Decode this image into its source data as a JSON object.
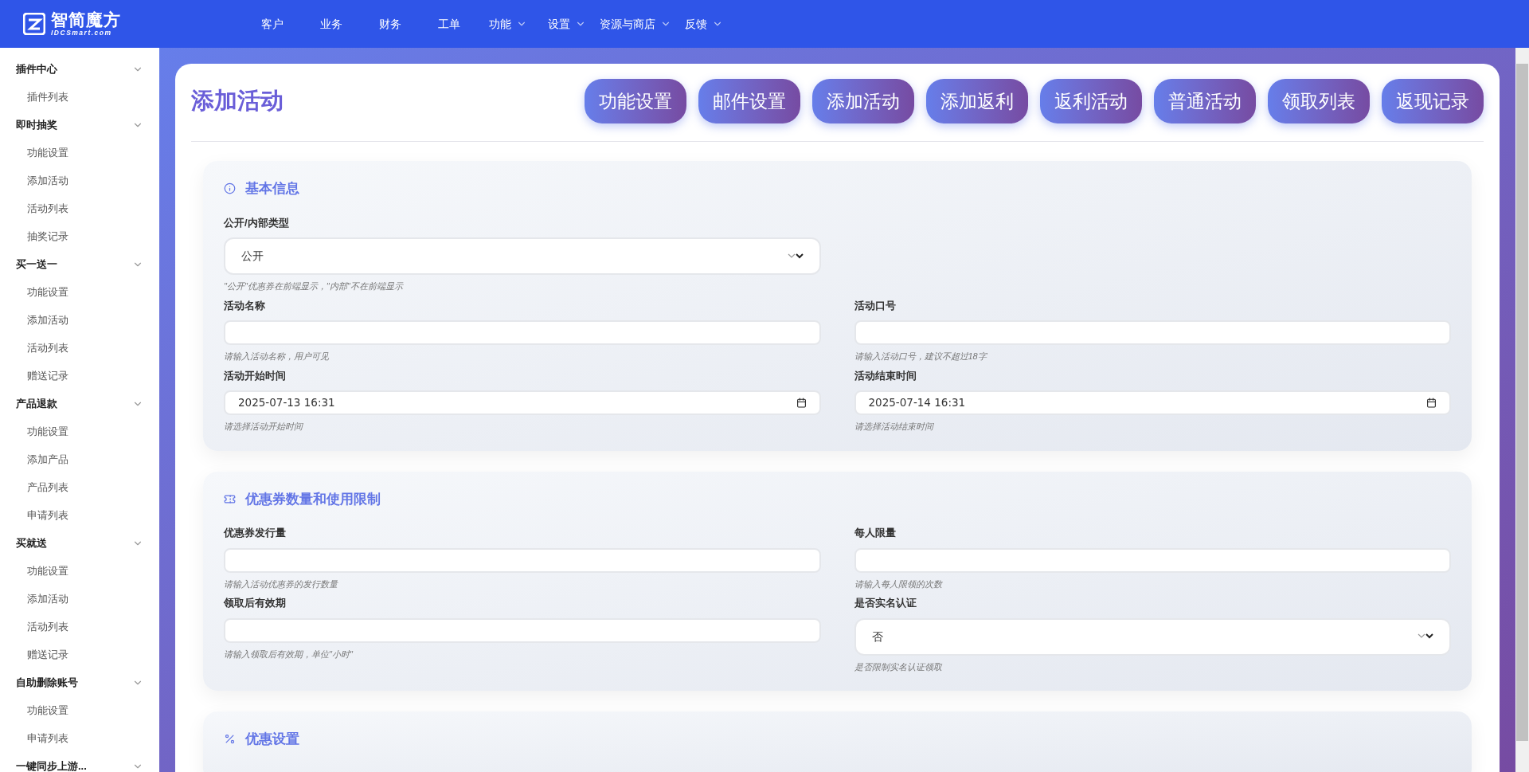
{
  "brand": {
    "name": "智简魔方",
    "domain": "IDCSmart.com"
  },
  "nav": [
    {
      "label": "客户",
      "dropdown": false
    },
    {
      "label": "业务",
      "dropdown": false
    },
    {
      "label": "财务",
      "dropdown": false
    },
    {
      "label": "工单",
      "dropdown": false
    },
    {
      "label": "功能",
      "dropdown": true
    },
    {
      "label": "设置",
      "dropdown": true
    },
    {
      "label": "资源与商店",
      "dropdown": true
    },
    {
      "label": "反馈",
      "dropdown": true
    }
  ],
  "sidebar": [
    {
      "label": "插件中心",
      "children": [
        "插件列表"
      ]
    },
    {
      "label": "即时抽奖",
      "children": [
        "功能设置",
        "添加活动",
        "活动列表",
        "抽奖记录"
      ]
    },
    {
      "label": "买一送一",
      "children": [
        "功能设置",
        "添加活动",
        "活动列表",
        "赠送记录"
      ]
    },
    {
      "label": "产品退款",
      "children": [
        "功能设置",
        "添加产品",
        "产品列表",
        "申请列表"
      ]
    },
    {
      "label": "买就送",
      "children": [
        "功能设置",
        "添加活动",
        "活动列表",
        "赠送记录"
      ]
    },
    {
      "label": "自助删除账号",
      "children": [
        "功能设置",
        "申请列表"
      ]
    },
    {
      "label": "一键同步上游..."
    }
  ],
  "page_title": "添加活动",
  "header_buttons": [
    "功能设置",
    "邮件设置",
    "添加活动",
    "添加返利",
    "返利活动",
    "普通活动",
    "领取列表",
    "返现记录"
  ],
  "sections": [
    {
      "title": "基本信息",
      "rows": [
        [
          {
            "kind": "select",
            "label": "公开/内部类型",
            "value": "公开",
            "hint": "\"公开\"优惠券在前端显示，\"内部\"不在前端显示"
          }
        ],
        [
          {
            "kind": "text",
            "label": "活动名称",
            "hint": "请输入活动名称，用户可见"
          },
          {
            "kind": "text",
            "label": "活动口号",
            "hint": "请输入活动口号，建议不超过18字"
          }
        ],
        [
          {
            "kind": "datetime",
            "label": "活动开始时间",
            "value": "2025-07-13 16:31",
            "hint": "请选择活动开始时间"
          },
          {
            "kind": "datetime",
            "label": "活动结束时间",
            "value": "2025-07-14 16:31",
            "hint": "请选择活动结束时间"
          }
        ]
      ]
    },
    {
      "title": "优惠券数量和使用限制",
      "rows": [
        [
          {
            "kind": "text",
            "label": "优惠券发行量",
            "hint": "请输入活动优惠券的发行数量"
          },
          {
            "kind": "text",
            "label": "每人限量",
            "hint": "请输入每人限领的次数"
          }
        ],
        [
          {
            "kind": "text",
            "label": "领取后有效期",
            "hint": "请输入领取后有效期，单位\"小时\""
          },
          {
            "kind": "select",
            "label": "是否实名认证",
            "value": "否",
            "hint": "是否限制实名认证领取"
          }
        ]
      ]
    },
    {
      "title": "优惠设置"
    }
  ]
}
